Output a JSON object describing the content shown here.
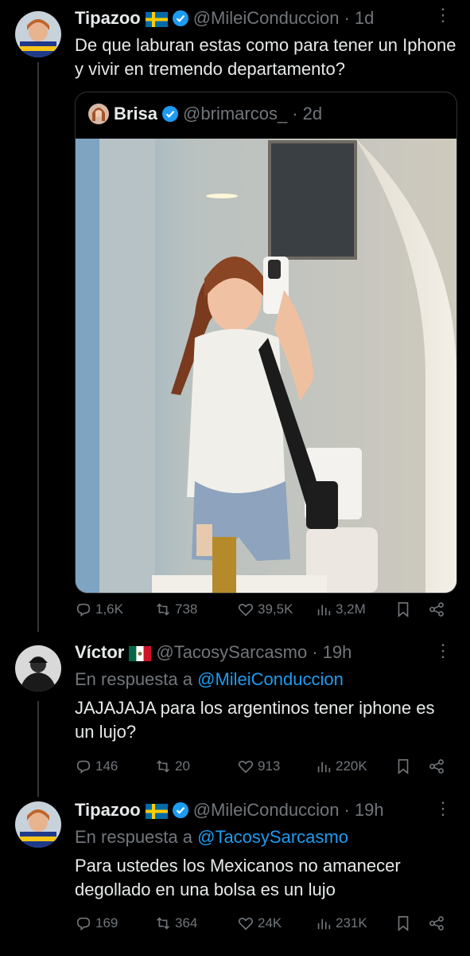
{
  "posts": [
    {
      "name": "Tipazoo",
      "flag": "sweden-flag",
      "handle": "@MileiConduccion",
      "time": "· 1d",
      "text": "De que laburan estas como para tener un Iphone y vivir en tremendo departamento?",
      "quote": {
        "name": "Brisa",
        "handle": "@brimarcos_",
        "time": "· 2d",
        "photo": "mirror selfie photo"
      },
      "metrics": {
        "replies": "1,6K",
        "reposts": "738",
        "likes": "39,5K",
        "views": "3,2M"
      }
    },
    {
      "name": "Víctor",
      "flag": "mexico-flag",
      "handle": "@TacosySarcasmo",
      "time": "· 19h",
      "reply_prefix": "En respuesta a",
      "reply_to": "@MileiConduccion",
      "text": "JAJAJAJA para los argentinos tener iphone es un lujo?",
      "metrics": {
        "replies": "146",
        "reposts": "20",
        "likes": "913",
        "views": "220K"
      }
    },
    {
      "name": "Tipazoo",
      "flag": "sweden-flag",
      "handle": "@MileiConduccion",
      "time": "· 19h",
      "reply_prefix": "En respuesta a",
      "reply_to": "@TacosySarcasmo",
      "text": "Para ustedes los Mexicanos no amanecer degollado en una bolsa es un lujo",
      "metrics": {
        "replies": "169",
        "reposts": "364",
        "likes": "24K",
        "views": "231K"
      }
    }
  ],
  "colors": {
    "background": "#000000",
    "text": "#e7e9ea",
    "muted": "#71767b",
    "link": "#1d9bf0",
    "verified": "#1d9bf0"
  }
}
